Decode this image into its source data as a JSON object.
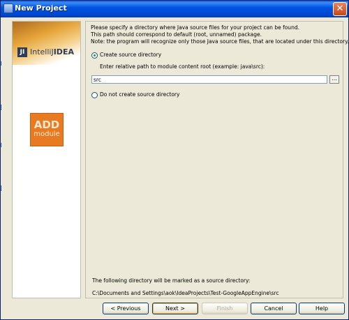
{
  "window": {
    "title": "New Project",
    "close_glyph": "✕"
  },
  "sidebar": {
    "logo_mark": "JI",
    "logo_prefix": "IntelliJ",
    "logo_suffix": "IDEA",
    "badge_top": "ADD",
    "badge_bottom": "module"
  },
  "panel": {
    "description_line1": "Please specify a directory where Java source files for your project can be found.",
    "description_line2": "This path should correspond to default (root, unnamed) package.",
    "description_line3": "Note: the program will recognize only those Java source files, that are located under this directory.",
    "option_create_label": "Create source directory",
    "option_create_selected": true,
    "path_prompt": "Enter relative path to module content root  (example: java\\src):",
    "path_value": "src",
    "browse_label": "...",
    "option_no_create_label": "Do not create source directory",
    "footer_label": "The following directory will be marked as a source directory:",
    "footer_path": "C:\\Documents and Settings\\aok\\IdeaProjects\\Test-GoogleAppEngine\\src"
  },
  "buttons": {
    "previous": "< Previous",
    "next": "Next >",
    "finish": "Finish",
    "cancel": "Cancel",
    "help": "Help"
  }
}
